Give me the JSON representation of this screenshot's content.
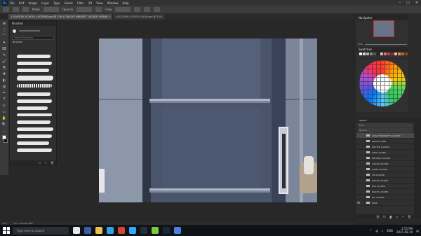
{
  "menubar": {
    "logo": "Ps",
    "items": [
      "File",
      "Edit",
      "Image",
      "Layer",
      "Type",
      "Select",
      "Filter",
      "3D",
      "View",
      "Window",
      "Help"
    ],
    "window_controls": [
      "–",
      "□",
      "✕"
    ]
  },
  "options": {
    "mode_label": "Mode",
    "opacity_label": "Opacity",
    "flow_label": "Flow"
  },
  "document_tabs": [
    {
      "label": "LOCATION: SCHOOL LOCKERS.psd @ 33% (COACH'S BRIDGET LOCKER, RGB/8) *",
      "active": true
    },
    {
      "label": "LOCATION: SCHOOL BLUE.psd @ 33%",
      "active": false
    }
  ],
  "tools": [
    "⊕",
    "⬚",
    "⌒",
    "✦",
    "⌧",
    "✎",
    "🖌",
    "⎘",
    "✚",
    "◐",
    "◍",
    "✒",
    "T",
    "▷",
    "▭",
    "✋",
    "🔍",
    "…"
  ],
  "brushes_panel": {
    "title": "Brushes",
    "search_placeholder": "Search Brushes",
    "folder": "Brushes"
  },
  "navigator": {
    "title": "Navigator",
    "zoom": "33%"
  },
  "swatches": {
    "title": "Swatches",
    "colors": [
      "#f2f2f2",
      "#d8d8d8",
      "#b0b0b0",
      "#8a8a8a",
      "#555",
      "#222",
      "#e6b3b3",
      "#c77",
      "#b44",
      "#a22",
      "#e9c6a8",
      "#d98f5a",
      "#b86b2f",
      "#8a4a1c"
    ]
  },
  "layers": {
    "title": "Layers",
    "filter": "Kind",
    "mode": "Normal",
    "opacity": "Opacity: 100%",
    "items": [
      {
        "label": "COACH BRIDGET'S LOCKER",
        "selected": true
      },
      {
        "label": "INFANT GABE",
        "selected": false
      },
      {
        "label": "DEXTER LOCKER",
        "selected": false
      },
      {
        "label": "JADE LOCKER",
        "selected": false
      },
      {
        "label": "RHONDA LOCKER",
        "selected": false
      },
      {
        "label": "LOGAN LOCKER",
        "selected": false
      },
      {
        "label": "DANIE LOCKER",
        "selected": false
      },
      {
        "label": "FIN LOCKER",
        "selected": false
      },
      {
        "label": "JUSTIN LOCKER",
        "selected": false
      },
      {
        "label": "EVE LOCKER",
        "selected": false
      },
      {
        "label": "BAILEY LOCKER",
        "selected": false
      },
      {
        "label": "MC LOCKER",
        "selected": false
      },
      {
        "label": "BASE",
        "selected": false
      }
    ]
  },
  "status": {
    "zoom": "33%",
    "doc": "Doc: 16.1M/1.48G"
  },
  "taskbar": {
    "search_placeholder": "Type here to search",
    "apps": [
      "#e8e8e8",
      "#3a5ea8",
      "#e8c24a",
      "#2fa3e6",
      "#d9452b",
      "#31a8ff",
      "#26303c",
      "#7ac943",
      "#1b2838",
      "#4f7de0"
    ],
    "lang": "ENG",
    "time": "2:55 PM",
    "date": "2021-08-10"
  }
}
